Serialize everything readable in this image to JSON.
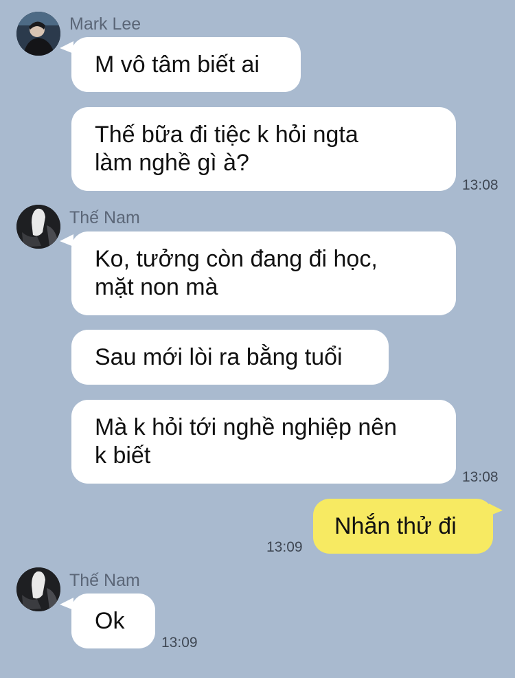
{
  "colors": {
    "background": "#a9bacf",
    "incoming_bubble": "#ffffff",
    "outgoing_bubble": "#f7ea62",
    "sender_name": "#5b6677",
    "timestamp": "#3f4753"
  },
  "messages": [
    {
      "sender": "Mark Lee",
      "avatar_icon": "user-avatar-icon",
      "text": "M vô tâm biết ai",
      "time": ""
    },
    {
      "sender": "",
      "text": "Thế bữa đi tiệc k hỏi ngta\nlàm nghề gì à?",
      "time": "13:08"
    },
    {
      "sender": "Thế Nam",
      "avatar_icon": "user-avatar-icon",
      "text": "Ko, tưởng còn đang đi học,\nmặt non mà",
      "time": ""
    },
    {
      "sender": "",
      "text": "Sau mới lòi ra bằng tuổi",
      "time": ""
    },
    {
      "sender": "",
      "text": "Mà k hỏi tới nghề nghiệp nên\nk biết",
      "time": "13:08"
    },
    {
      "sender": "me",
      "text": "Nhắn thử đi",
      "time": "13:09"
    },
    {
      "sender": "Thế Nam",
      "avatar_icon": "user-avatar-icon",
      "text": "Ok",
      "time": "13:09"
    }
  ]
}
